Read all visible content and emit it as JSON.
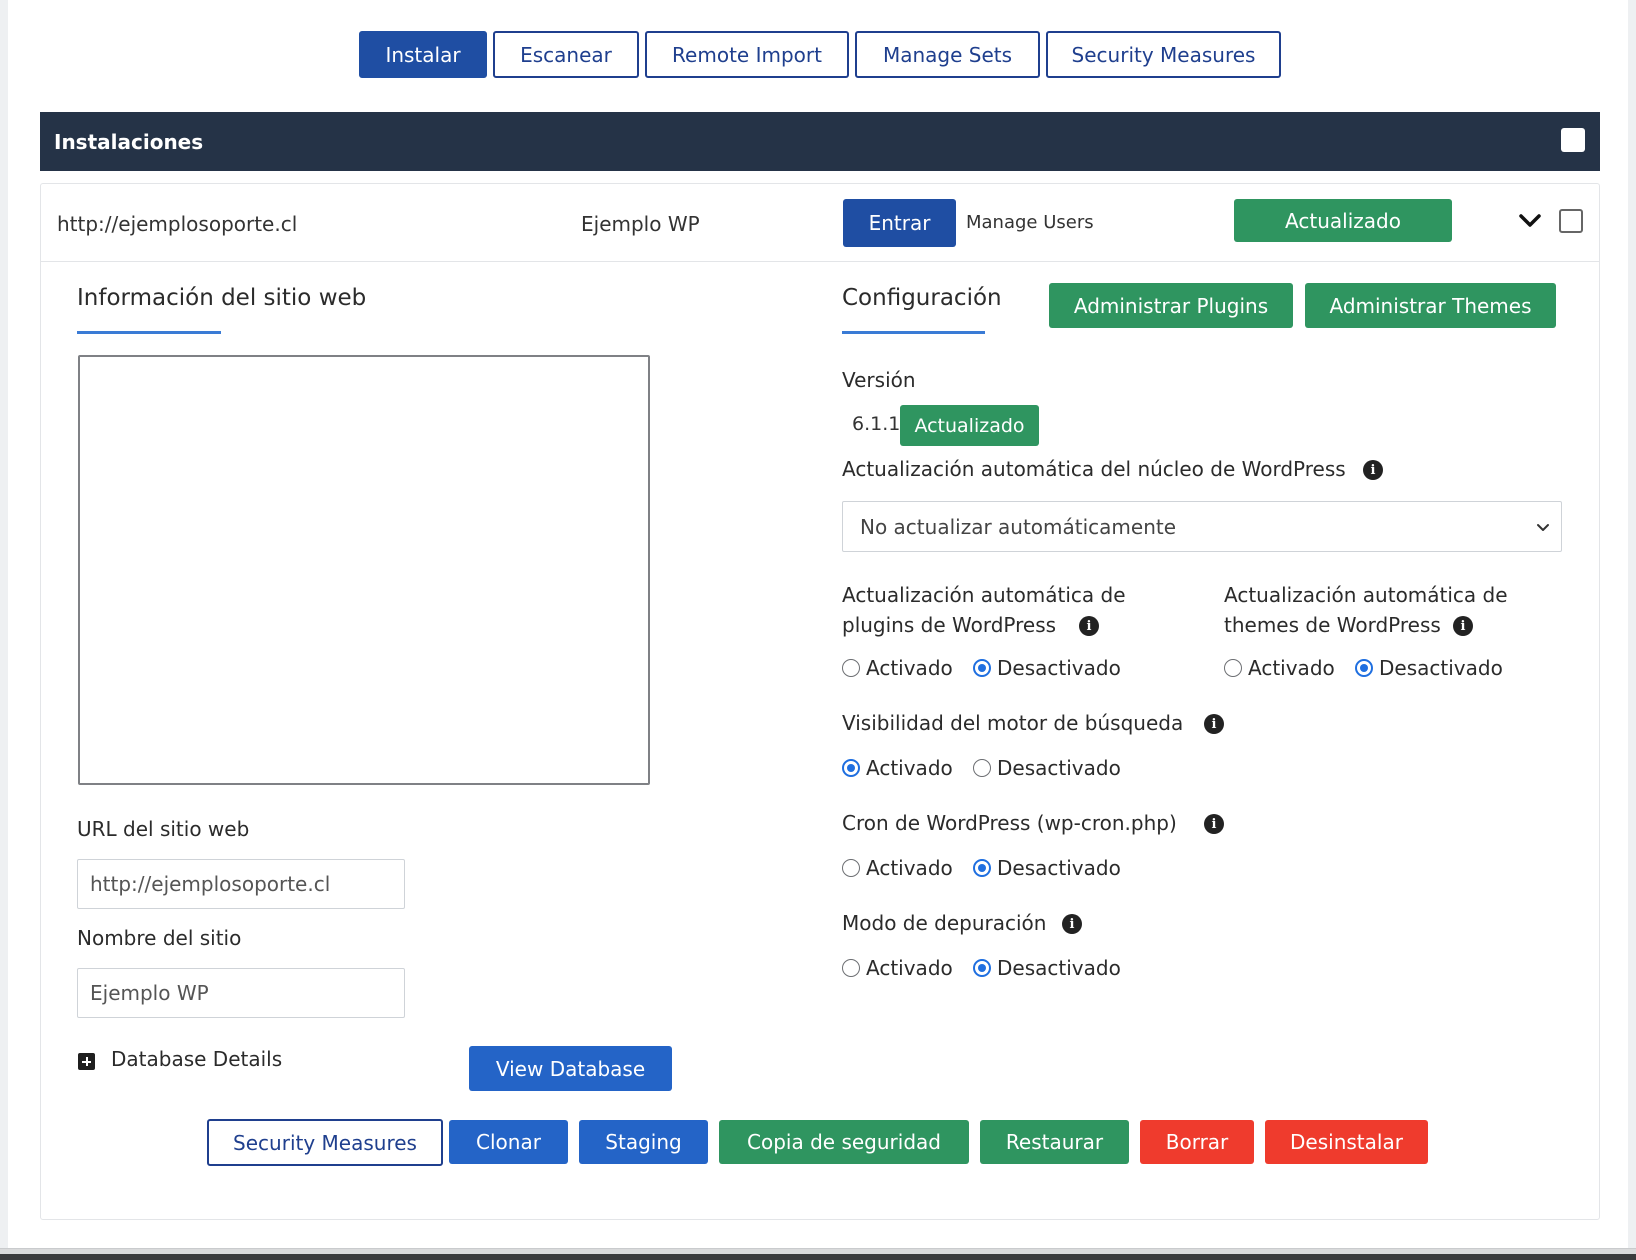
{
  "tabs": [
    {
      "label": "Instalar",
      "active": true
    },
    {
      "label": "Escanear",
      "active": false
    },
    {
      "label": "Remote Import",
      "active": false
    },
    {
      "label": "Manage Sets",
      "active": false
    },
    {
      "label": "Security Measures",
      "active": false
    }
  ],
  "header": {
    "title": "Instalaciones"
  },
  "installation": {
    "url": "http://ejemplosoporte.cl",
    "name": "Ejemplo WP",
    "enter_label": "Entrar",
    "manage_users_label": "Manage Users",
    "status_label": "Actualizado"
  },
  "site_info": {
    "title": "Información del sitio web",
    "url_label": "URL del sitio web",
    "url_value": "http://ejemplosoporte.cl",
    "name_label": "Nombre del sitio",
    "name_value": "Ejemplo WP",
    "database_details_label": "Database Details",
    "view_database_label": "View Database"
  },
  "config": {
    "title": "Configuración",
    "manage_plugins_label": "Administrar Plugins",
    "manage_themes_label": "Administrar Themes",
    "version_label": "Versión",
    "version_value": "6.1.1",
    "version_status": "Actualizado",
    "core_update_label": "Actualización automática del núcleo de WordPress",
    "core_update_selected": "No actualizar automáticamente",
    "plugins_update_label_1": "Actualización automática de",
    "plugins_update_label_2": "plugins de WordPress",
    "themes_update_label_1": "Actualización automática de",
    "themes_update_label_2": "themes de WordPress",
    "search_visibility_label": "Visibilidad del motor de búsqueda",
    "cron_label": "Cron de WordPress (wp-cron.php)",
    "debug_label": "Modo de depuración",
    "on_label": "Activado",
    "off_label": "Desactivado",
    "plugins_update_enabled": false,
    "themes_update_enabled": false,
    "search_visibility_enabled": true,
    "cron_enabled": false,
    "debug_enabled": false
  },
  "actions": {
    "security_label": "Security Measures",
    "clone_label": "Clonar",
    "staging_label": "Staging",
    "backup_label": "Copia de seguridad",
    "restore_label": "Restaurar",
    "delete_label": "Borrar",
    "uninstall_label": "Desinstalar"
  },
  "colors": {
    "primary": "#1f4ea3",
    "success": "#2f9560",
    "danger": "#ef3b2d",
    "header": "#253347",
    "accent_underline": "#3a7bd5"
  },
  "icons": [
    "checkbox-icon",
    "chevron-down-icon",
    "info-icon",
    "plus-square-icon",
    "select-arrow-icon"
  ]
}
